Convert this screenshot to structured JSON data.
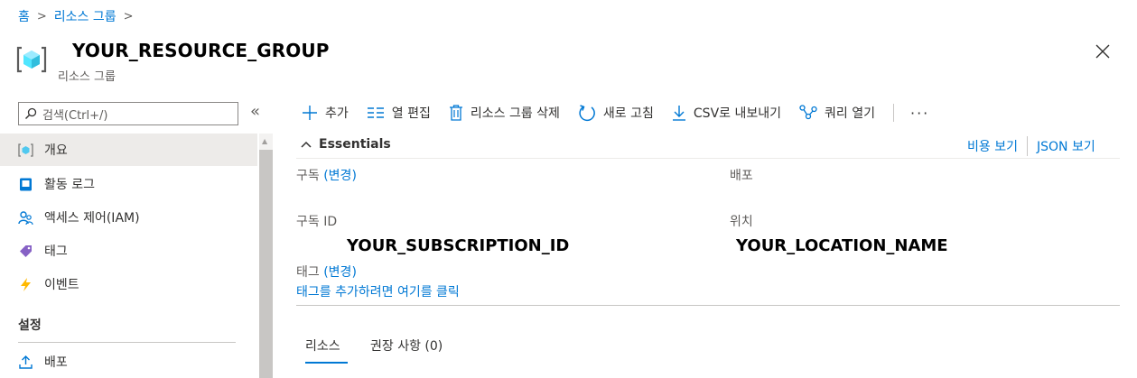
{
  "breadcrumb": {
    "home": "홈",
    "resource_groups": "리소스 그룹"
  },
  "header": {
    "title": "YOUR_RESOURCE_GROUP",
    "subtitle": "리소스 그룹",
    "icon": "resource-group-icon"
  },
  "sidebar": {
    "search_placeholder": "검색(Ctrl+/)",
    "collapse_label": "«",
    "items": [
      {
        "label": "개요",
        "icon": "overview-icon",
        "active": true
      },
      {
        "label": "활동 로그",
        "icon": "activity-log-icon"
      },
      {
        "label": "액세스 제어(IAM)",
        "icon": "iam-icon"
      },
      {
        "label": "태그",
        "icon": "tag-icon"
      },
      {
        "label": "이벤트",
        "icon": "events-icon"
      }
    ],
    "section_settings": "설정",
    "settings_items": [
      {
        "label": "배포",
        "icon": "deployments-icon"
      }
    ]
  },
  "toolbar": {
    "add": "추가",
    "edit_columns": "열 편집",
    "delete_group": "리소스 그룹 삭제",
    "refresh": "새로 고침",
    "export_csv": "CSV로 내보내기",
    "open_query": "쿼리 열기",
    "more": "···"
  },
  "essentials": {
    "heading": "Essentials",
    "cost_view": "비용 보기",
    "json_view": "JSON 보기",
    "subscription_label": "구독",
    "change_link": "(변경)",
    "deployment_label": "배포",
    "subscription_id_label": "구독 ID",
    "subscription_id_value": "YOUR_SUBSCRIPTION_ID",
    "location_label": "위치",
    "location_value": "YOUR_LOCATION_NAME",
    "tags_label": "태그",
    "tags_change": "(변경)",
    "tags_add": "태그를 추가하려면 여기를 클릭"
  },
  "tabs": {
    "resources": "리소스",
    "recommendations": "권장 사항 (0)"
  },
  "colors": {
    "accent": "#0078d4",
    "nav_active": "#edebe9"
  }
}
